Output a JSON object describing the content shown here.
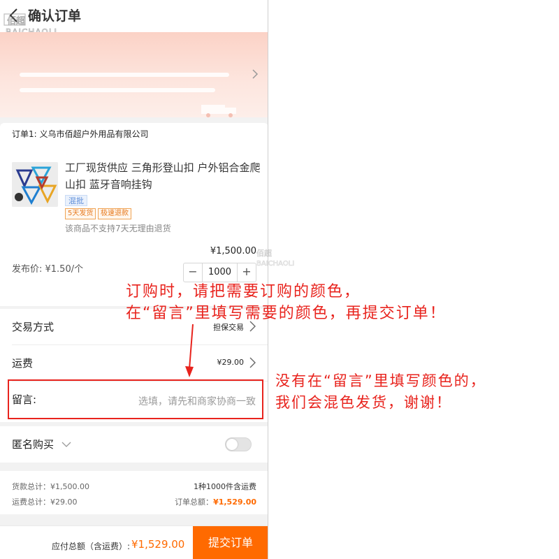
{
  "header": {
    "title": "确认订单",
    "watermark_text": "佰超 BAICHAOLI"
  },
  "order": {
    "supplier_label": "订单1: 义乌市佰超户外用品有限公司",
    "product": {
      "title": "工厂现货供应 三角形登山扣 户外铝合金爬山扣 蓝牙音响挂钩",
      "mixed_tag": "混批",
      "ship_tag": "5天发货",
      "refund_tag": "极速退款",
      "return_note": "该商品不支持7天无理由退货"
    },
    "line_total": "¥1,500.00",
    "unit_price": "发布价: ¥1.50/个",
    "quantity": "1000",
    "minus_label": "−",
    "plus_label": "+"
  },
  "rows": {
    "trade_label": "交易方式",
    "trade_value": "担保交易",
    "shipping_label": "运费",
    "shipping_value": "¥29.00",
    "message_label": "留言:",
    "message_placeholder": "选填，请先和商家协商一致"
  },
  "anonymous": {
    "label": "匿名购买",
    "enabled": false
  },
  "summary": {
    "goods_total": "货款总计：¥1,500.00",
    "freight_total": "运费总计：¥29.00",
    "item_count": "1种1000件含运费",
    "order_total_label": "订单总额：",
    "order_total_value": "¥1,529.00"
  },
  "footer": {
    "payable_label": "应付总额（含运费）:",
    "payable_amount": "¥1,529.00",
    "submit_label": "提交订单"
  },
  "annotations": {
    "note1_line1": "订购时，请把需要订购的颜色，",
    "note1_line2": "在“留言”里填写需要的颜色，再提交订单！",
    "note2_line1": "没有在“留言”里填写颜色的，",
    "note2_line2": "我们会混色发货，谢谢！"
  },
  "colors": {
    "accent": "#ff6a00",
    "annotation_red": "#e8231d",
    "banner_pink": "#fbd2c6"
  }
}
